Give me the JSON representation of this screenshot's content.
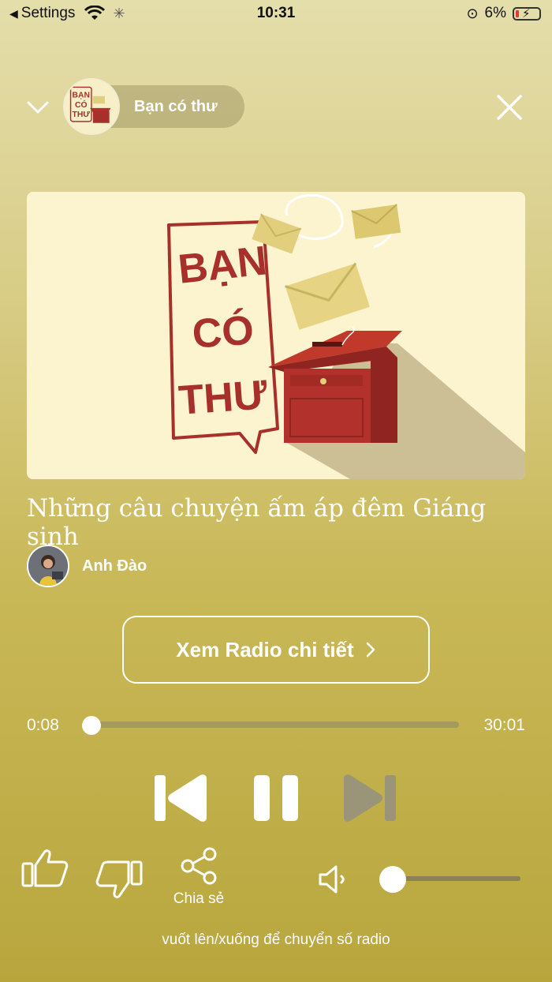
{
  "status_bar": {
    "back_label": "Settings",
    "time": "10:31",
    "battery": "6%"
  },
  "station": {
    "name": "Bạn có thư",
    "logo_text": [
      "BẠN",
      "CÓ",
      "THƯ"
    ]
  },
  "artwork": {
    "logo_text": [
      "BẠN",
      "CÓ",
      "THƯ"
    ]
  },
  "episode": {
    "title": "Những câu chuyện ấm áp đêm Giáng sinh",
    "author": "Anh Đào"
  },
  "detail_button": {
    "label": "Xem Radio chi tiết"
  },
  "player": {
    "current_time": "0:08",
    "total_time": "30:01",
    "progress": 0.004
  },
  "actions": {
    "share_label": "Chia sẻ"
  },
  "volume": {
    "level": 0.0
  },
  "hint": "vuốt lên/xuống để chuyển số radio",
  "colors": {
    "bg_top": "#e4deab",
    "bg_bottom": "#b8a63d",
    "mailbox_red": "#b3312c",
    "envelope": "#e2cf7e"
  }
}
